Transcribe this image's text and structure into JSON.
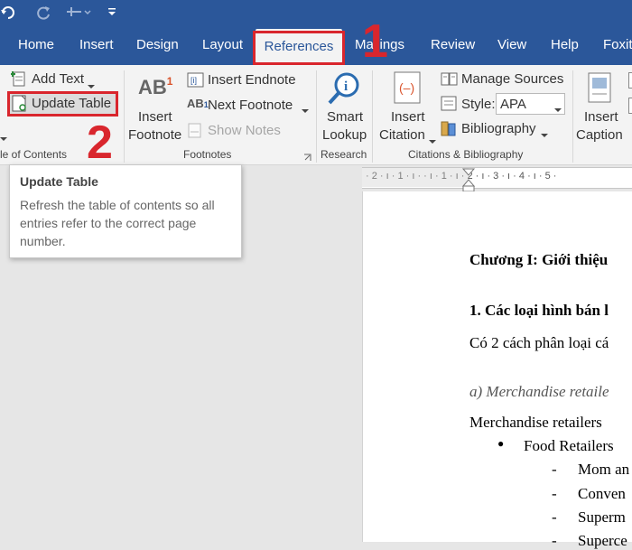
{
  "qat": {
    "undo_icon": "undo-icon",
    "redo_icon": "redo-icon",
    "customize_icon": "customize-icon"
  },
  "tabs": [
    {
      "label": "Home"
    },
    {
      "label": "Insert"
    },
    {
      "label": "Design"
    },
    {
      "label": "Layout"
    },
    {
      "label": "References",
      "active": true
    },
    {
      "label": "Mailings"
    },
    {
      "label": "Review"
    },
    {
      "label": "View"
    },
    {
      "label": "Help"
    },
    {
      "label": "Foxit"
    }
  ],
  "steps": {
    "one": "1",
    "two": "2"
  },
  "ribbon": {
    "toc": {
      "add_text": "Add Text",
      "update_table": "Update Table",
      "group": "le of Contents"
    },
    "footnotes": {
      "insert_footnote_1": "Insert",
      "insert_footnote_2": "Footnote",
      "insert_endnote": "Insert Endnote",
      "next_footnote": "Next Footnote",
      "show_notes": "Show Notes",
      "group": "Footnotes",
      "ab_glyph": "AB",
      "superscript": "1"
    },
    "research": {
      "smart_1": "Smart",
      "smart_2": "Lookup",
      "group": "Research"
    },
    "citations": {
      "insert_citation_1": "Insert",
      "insert_citation_2": "Citation",
      "manage_sources": "Manage Sources",
      "style_label": "Style:",
      "style_value": "APA",
      "bibliography": "Bibliography",
      "group": "Citations & Bibliography"
    },
    "captions": {
      "insert_caption_1": "Insert",
      "insert_caption_2": "Caption"
    }
  },
  "tooltip": {
    "title": "Update Table",
    "line1": "Refresh the table of contents so all",
    "line2": "entries refer to the correct page",
    "line3": "number."
  },
  "ruler": {
    "marks": "· 2 · ı · 1 · ı ·    · ı · 1 · ı · 2 · ı · 3 · ı · 4 · ı · 5 ·"
  },
  "document": {
    "chapter": "Chương I: Giới thiệu",
    "heading1": "1. Các loại hình bán l",
    "para1": "Có 2 cách phân loại cá",
    "subhead": "a) Merchandise retaile",
    "para2": "Merchandise retailers",
    "bullet_symbol": "●",
    "bullet1": "Food Retailers",
    "dash": "-",
    "sub1": "Mom an",
    "sub2": "Conven",
    "sub3": "Superm",
    "sub4": "Superce"
  }
}
